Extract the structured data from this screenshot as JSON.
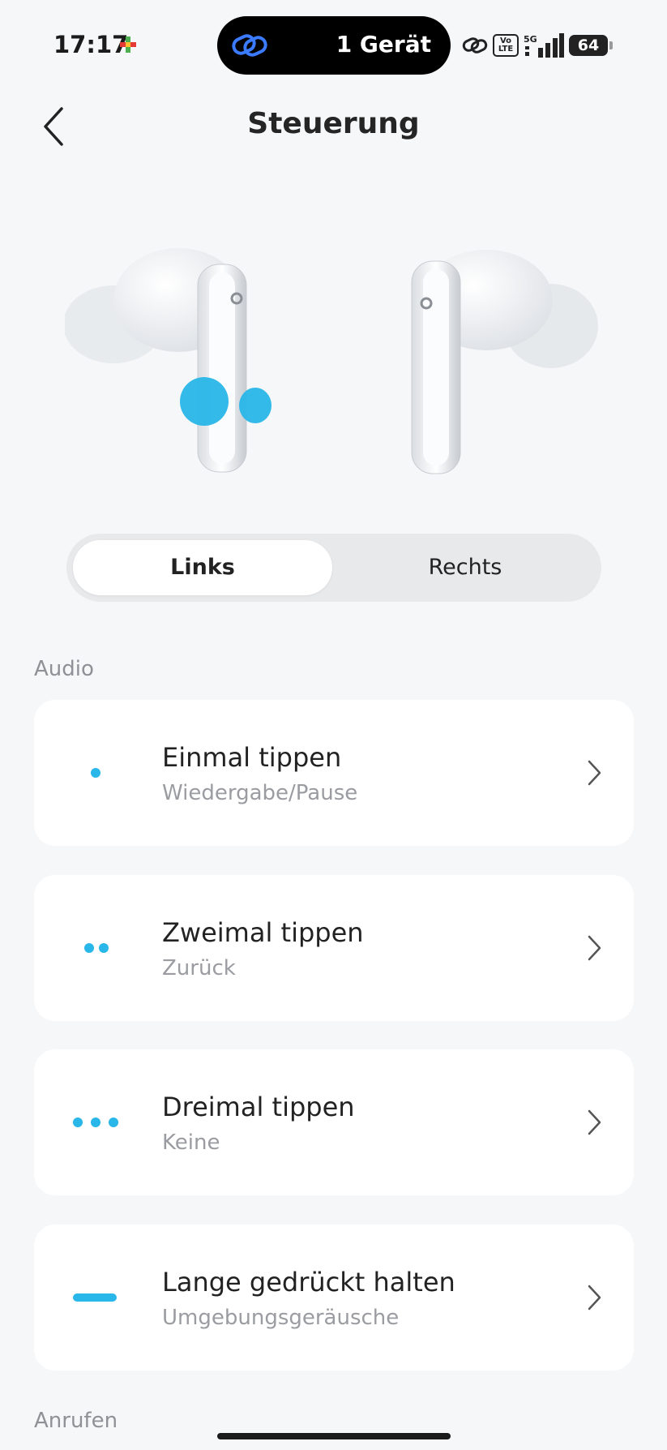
{
  "status": {
    "time": "17:17",
    "island_text": "1 Gerät",
    "volte": "Vo LTE",
    "network": "5G",
    "battery": "64"
  },
  "header": {
    "title": "Steuerung"
  },
  "tabs": {
    "left": "Links",
    "right": "Rechts",
    "selected": "Links"
  },
  "sections": {
    "audio": "Audio",
    "calls": "Anrufen"
  },
  "controls": [
    {
      "title": "Einmal tippen",
      "action": "Wiedergabe/Pause",
      "icon": "single-tap-icon"
    },
    {
      "title": "Zweimal tippen",
      "action": "Zurück",
      "icon": "double-tap-icon"
    },
    {
      "title": "Dreimal tippen",
      "action": "Keine",
      "icon": "triple-tap-icon"
    },
    {
      "title": "Lange gedrückt halten",
      "action": "Umgebungsgeräusche",
      "icon": "long-press-icon"
    }
  ],
  "colors": {
    "accent": "#29b6e8",
    "background": "#f6f7f9",
    "card": "#ffffff"
  }
}
